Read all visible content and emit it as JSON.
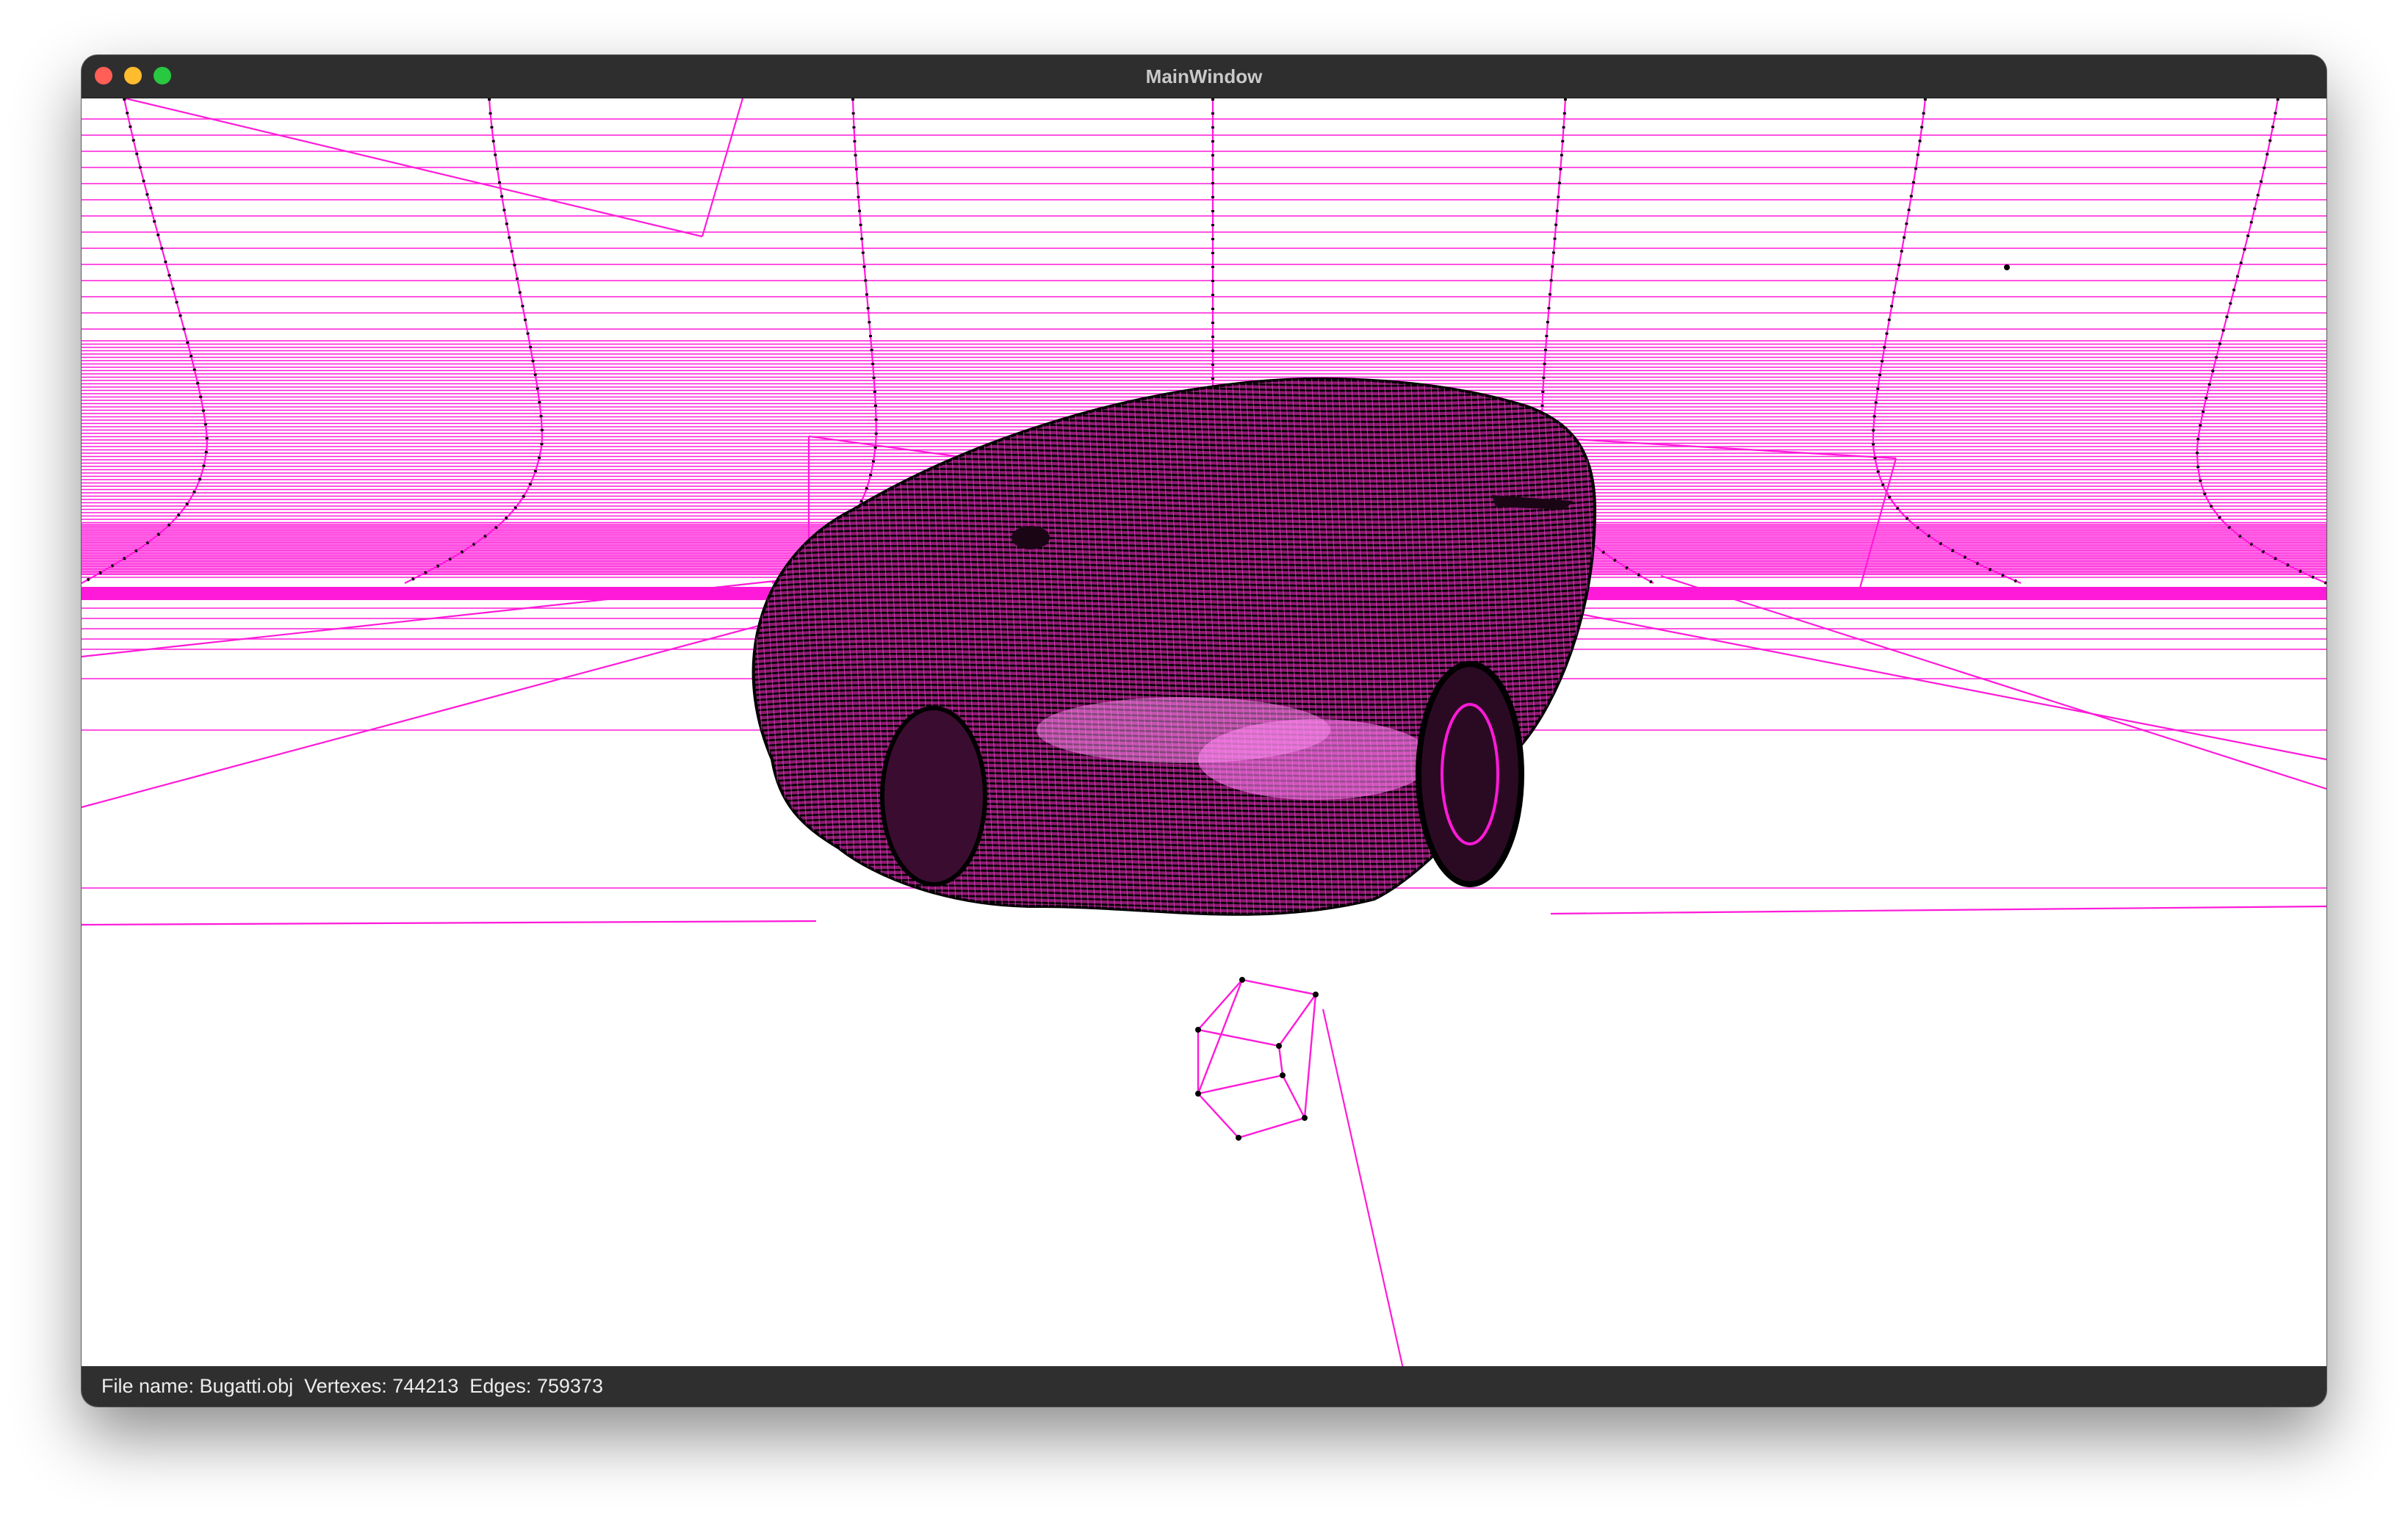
{
  "window": {
    "title": "MainWindow"
  },
  "traffic_lights": [
    {
      "name": "close",
      "color": "#ff5f57"
    },
    {
      "name": "minimize",
      "color": "#febc2e"
    },
    {
      "name": "zoom",
      "color": "#28c840"
    }
  ],
  "viewer": {
    "background": "#ffffff",
    "edge_color": "#ff1ad9",
    "vertex_color": "#000000",
    "model_fill": "#8a1a6e"
  },
  "status_bar": {
    "text": "File name: Bugatti.obj  Vertexes: 744213  Edges: 759373"
  }
}
